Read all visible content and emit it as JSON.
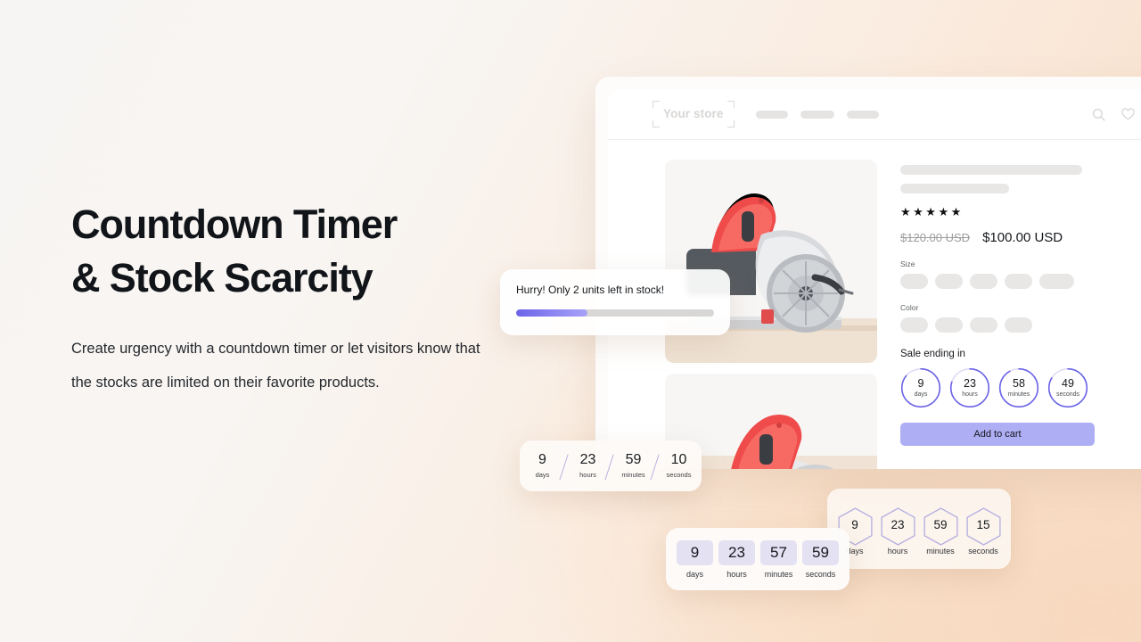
{
  "hero": {
    "headline_line1": "Countdown Timer",
    "headline_line2": "& Stock Scarcity",
    "subcopy": "Create urgency with a countdown timer or let visitors know that the stocks are limited on their favorite products."
  },
  "store": {
    "logo_label": "Your store",
    "nav_pill_widths": [
      36,
      38,
      36
    ],
    "icons": [
      "search-icon",
      "heart-icon",
      "cart-icon"
    ]
  },
  "product": {
    "rating_stars": "★★★★★",
    "price_old": "$120.00 USD",
    "price_new": "$100.00 USD",
    "size_label": "Size",
    "size_option_count": 5,
    "color_label": "Color",
    "color_option_count": 4,
    "sale_label": "Sale ending in",
    "add_to_cart_label": "Add to cart"
  },
  "ring_timer": {
    "units": [
      {
        "value": "9",
        "label": "days",
        "progress": 0.86
      },
      {
        "value": "23",
        "label": "hours",
        "progress": 0.8
      },
      {
        "value": "58",
        "label": "minutes",
        "progress": 0.92
      },
      {
        "value": "49",
        "label": "seconds",
        "progress": 0.84
      }
    ]
  },
  "stock_card": {
    "message": "Hurry! Only 2 units left in stock!",
    "progress_percent": 36
  },
  "slash_timer": {
    "units": [
      {
        "value": "9",
        "label": "days"
      },
      {
        "value": "23",
        "label": "hours"
      },
      {
        "value": "59",
        "label": "minutes"
      },
      {
        "value": "10",
        "label": "seconds"
      }
    ]
  },
  "boxed_timer": {
    "units": [
      {
        "value": "9",
        "label": "days"
      },
      {
        "value": "23",
        "label": "hours"
      },
      {
        "value": "57",
        "label": "minutes"
      },
      {
        "value": "59",
        "label": "seconds"
      }
    ]
  },
  "hex_timer": {
    "units": [
      {
        "value": "9",
        "label": "days"
      },
      {
        "value": "23",
        "label": "hours"
      },
      {
        "value": "59",
        "label": "minutes"
      },
      {
        "value": "15",
        "label": "seconds"
      }
    ]
  },
  "colors": {
    "accent": "#aeaef4",
    "progress_start": "#6c63e8",
    "ring_track": "#ded9f6",
    "ring_arc": "#6b63e6",
    "background_warm": "#f8dcc4"
  }
}
